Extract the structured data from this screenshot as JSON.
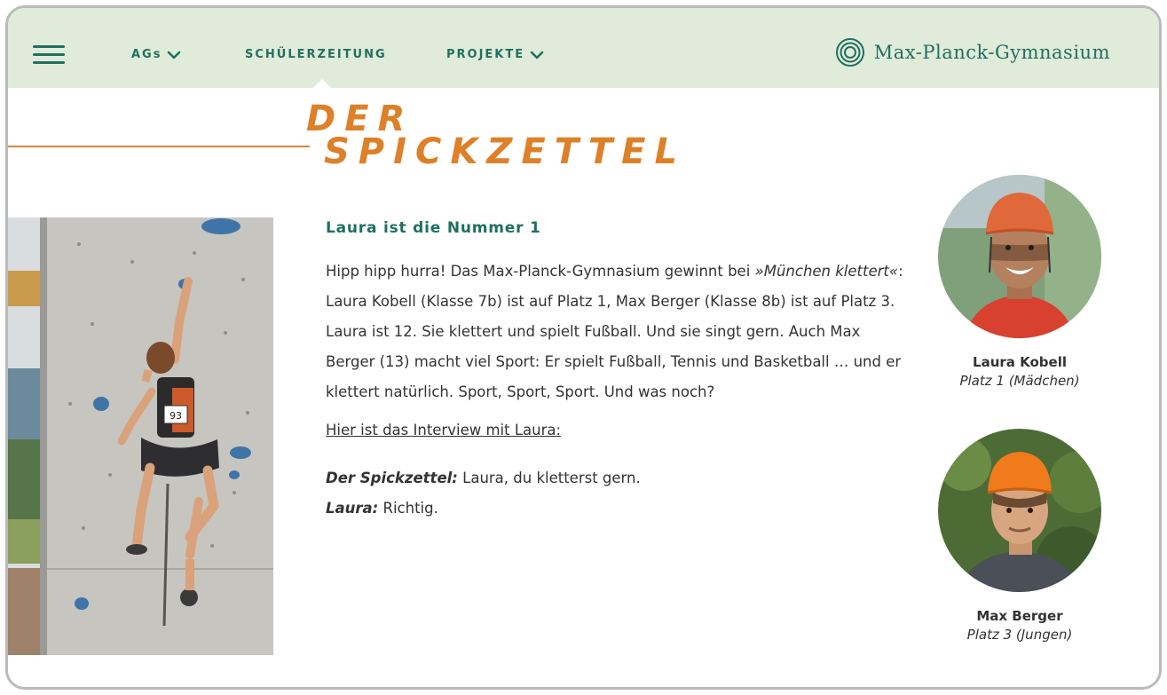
{
  "header": {
    "nav": [
      {
        "label": "AGs",
        "has_dropdown": true
      },
      {
        "label": "SCHÜLERZEITUNG",
        "has_dropdown": false,
        "active": true
      },
      {
        "label": "PROJEKTE",
        "has_dropdown": true
      }
    ],
    "brand_name": "Max-Planck-Gymnasium"
  },
  "title": {
    "line1": "DER",
    "line2": "SPICKZETTEL"
  },
  "article": {
    "heading": "Laura ist die Nummer 1",
    "body_parts": {
      "p1": "Hipp hipp hurra! Das Max-Planck-Gymnasium gewinnt bei ",
      "event": "»München klettert«",
      "p2": ": Laura Kobell (Klasse 7b) ist auf Platz 1, Max Berger (Klasse 8b) ist auf Platz 3. Laura ist 12. Sie klettert und spielt Fußball. Und sie singt gern. Auch Max Berger (13) macht viel Sport: Er spielt Fußball, Tennis und Basketball … und er klettert natürlich. Sport, Sport, Sport. Und was noch?"
    },
    "interview_link": "Hier ist das Interview mit Laura:",
    "dialog": [
      {
        "speaker": "Der Spickzettel:",
        "text": " Laura, du kletterst gern."
      },
      {
        "speaker": "Laura:",
        "text": " Richtig."
      }
    ]
  },
  "profiles": [
    {
      "name": "Laura Kobell",
      "rank": "Platz 1 (Mädchen)"
    },
    {
      "name": "Max Berger",
      "rank": "Platz 3 (Jungen)"
    }
  ],
  "climber_bib": "93",
  "colors": {
    "header_bg": "#e1ebda",
    "brand_green": "#1f7060",
    "title_orange": "#de8028",
    "text": "#333333",
    "frame_border": "#b9bcbc"
  },
  "icons": [
    "hamburger-icon",
    "chevron-down-icon",
    "brand-logo-icon"
  ]
}
